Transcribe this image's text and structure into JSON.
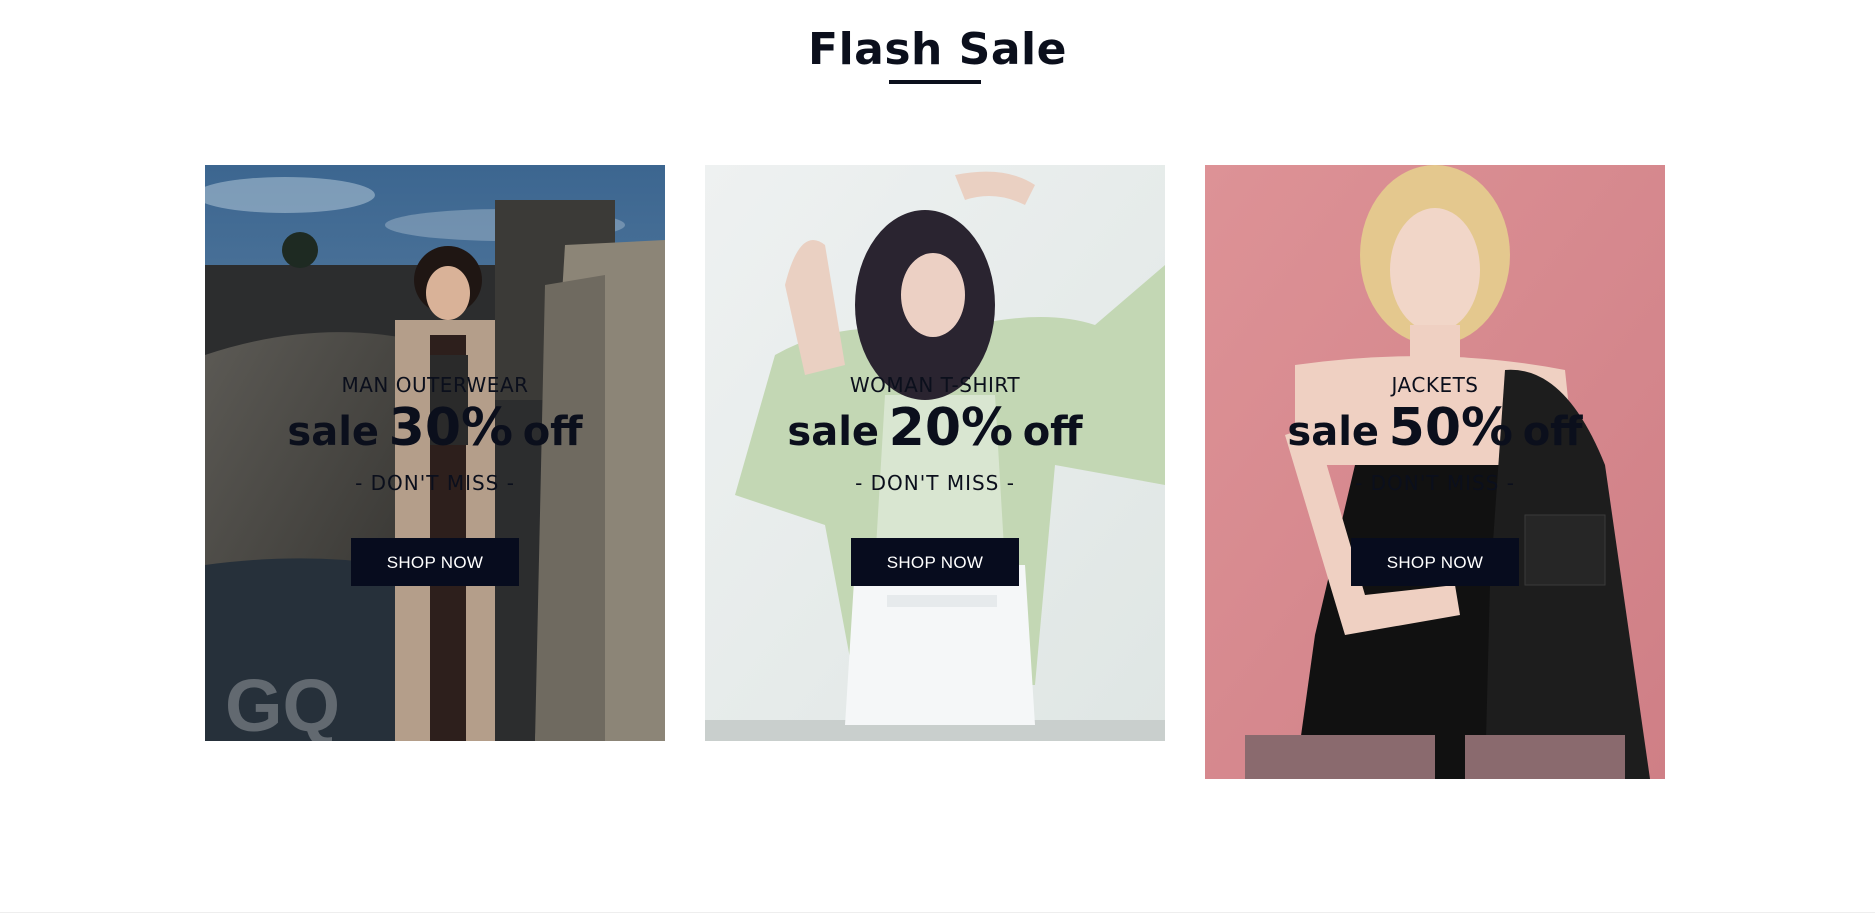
{
  "section": {
    "title": "Flash Sale"
  },
  "cards": [
    {
      "category": "MAN OUTERWEAR",
      "sale_word": "sale",
      "percent": "30%",
      "off_word": "off",
      "tagline": "- DON'T MISS -",
      "button_label": "SHOP NOW",
      "watermark": "GQ",
      "image_subject": "man-in-tan-long-vest-outdoors"
    },
    {
      "category": "WOMAN T-SHIRT",
      "sale_word": "sale",
      "percent": "20%",
      "off_word": "off",
      "tagline": "- DON'T MISS -",
      "button_label": "SHOP NOW",
      "image_subject": "woman-in-green-jacket-white-shorts"
    },
    {
      "category": "JACKETS",
      "sale_word": "sale",
      "percent": "50%",
      "off_word": "off",
      "tagline": "- DON'T MISS -",
      "button_label": "SHOP NOW",
      "image_subject": "blonde-woman-black-tweed-jacket-pink-backdrop"
    }
  ],
  "colors": {
    "text": "#0b0f1c",
    "button_bg": "#070c1e",
    "button_text": "#ffffff",
    "card3_backdrop": "#d98c93"
  }
}
